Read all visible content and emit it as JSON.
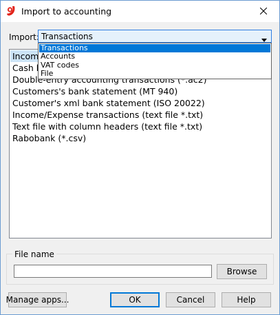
{
  "window": {
    "title": "Import to accounting",
    "icon": "banana-app-icon",
    "close_icon": "close-icon"
  },
  "import": {
    "label": "Import:",
    "selected": "Transactions",
    "options": [
      "Transactions",
      "Accounts",
      "VAT codes",
      "File"
    ]
  },
  "list": {
    "items": [
      "Income",
      "Cash b",
      "Double-entry accounting transactions (*.ac2)",
      "Customers's bank statement (MT 940)",
      "Customer's xml bank statement (ISO 20022)",
      "Income/Expense transactions (text file *.txt)",
      "Text file with column headers (text file *.txt)",
      "Rabobank (*.csv)"
    ],
    "selected_index": 0
  },
  "file": {
    "group_label": "File name",
    "value": "",
    "browse_label": "Browse"
  },
  "buttons": {
    "manage_apps": "Manage apps...",
    "ok": "OK",
    "cancel": "Cancel",
    "help": "Help"
  },
  "colors": {
    "selection_blue": "#0078d7",
    "list_selected_bg": "#cce4f7",
    "combo_focus_bg": "#e5f1fb",
    "app_icon_red": "#e2231a"
  }
}
